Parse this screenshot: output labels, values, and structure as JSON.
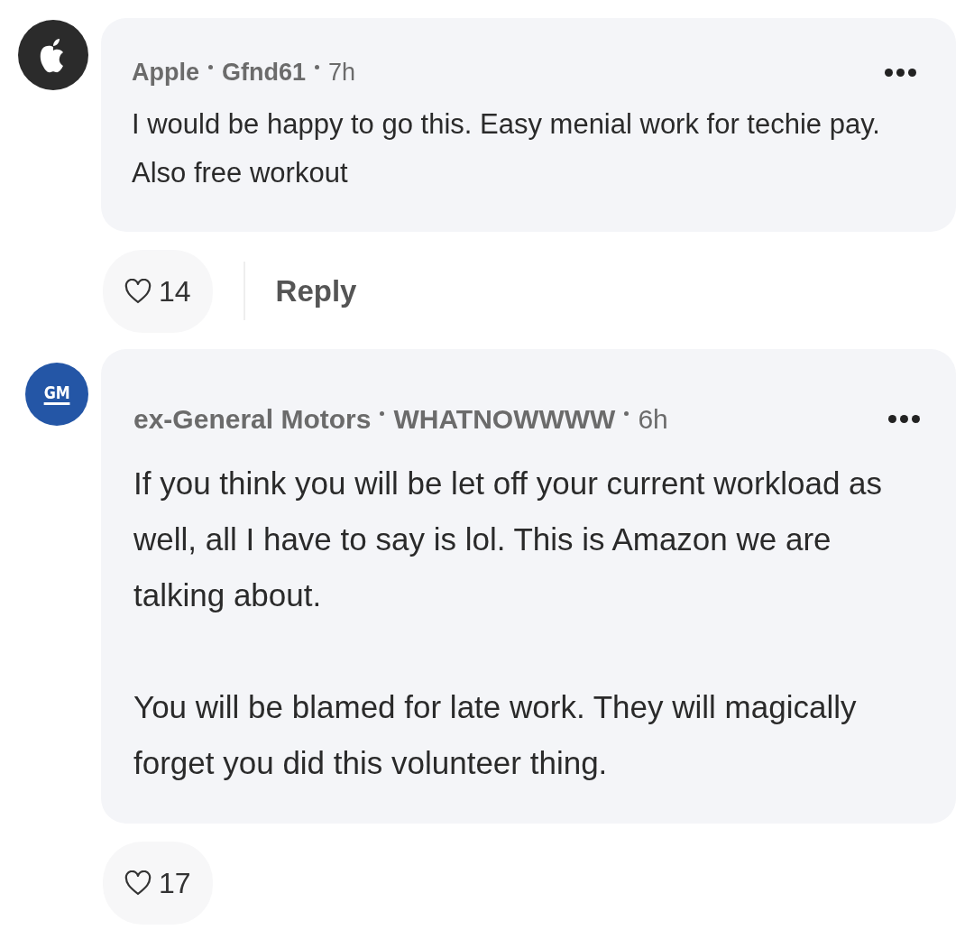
{
  "comments": [
    {
      "avatar": {
        "kind": "apple",
        "color": "#2b2b2b"
      },
      "company": "Apple",
      "user": "Gfnd61",
      "time": "7h",
      "paragraphs": [
        "I would be happy to go this. Easy menial work for techie pay. Also free workout"
      ],
      "actions": [
        {
          "kind": "like",
          "count": "14"
        },
        {
          "kind": "reply",
          "label": "Reply"
        }
      ]
    },
    {
      "avatar": {
        "kind": "text",
        "text": "GM",
        "color": "#2456a6"
      },
      "company": "ex-General Motors",
      "user": "WHATNOWWWW",
      "time": "6h",
      "paragraphs": [
        "If you think you will be let off your current workload as well, all I have to say is lol. This is Amazon we are talking about.",
        "You will be blamed for late work. They will magically forget you did this volunteer thing."
      ],
      "actions": [
        {
          "kind": "like",
          "count": "17"
        }
      ]
    }
  ]
}
